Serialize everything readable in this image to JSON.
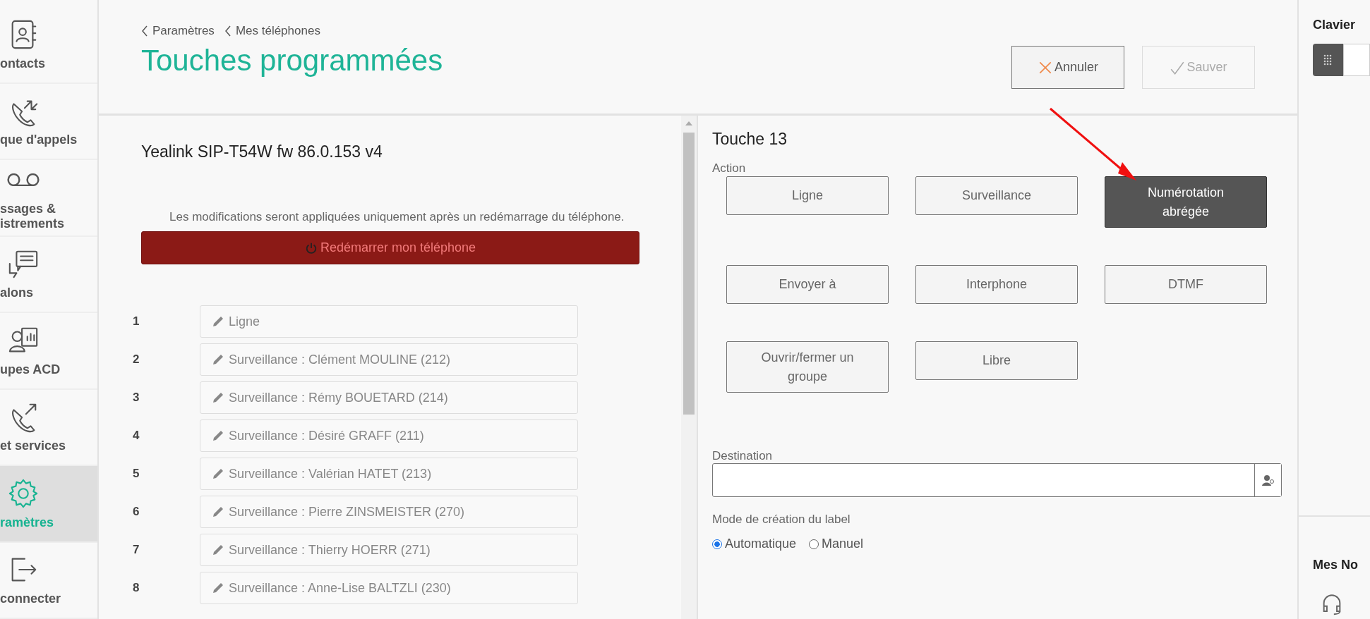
{
  "sidebar": {
    "items": [
      {
        "label": "ontacts",
        "kind": "contacts",
        "selected": false
      },
      {
        "label": "que d'appels",
        "kind": "history",
        "selected": false
      },
      {
        "label": "ssages &\nistrements",
        "kind": "voicemail",
        "selected": false
      },
      {
        "label": "alons",
        "kind": "chat",
        "selected": false
      },
      {
        "label": "upes ACD",
        "kind": "acd",
        "selected": false
      },
      {
        "label": "et services",
        "kind": "services",
        "selected": false
      },
      {
        "label": "ramètres",
        "kind": "settings",
        "selected": true
      },
      {
        "label": "connecter",
        "kind": "logout",
        "selected": false
      }
    ]
  },
  "header": {
    "breadcrumbs": [
      "Paramètres",
      "Mes téléphones"
    ],
    "title": "Touches programmées",
    "buttons": [
      {
        "label": "Annuler",
        "kind": "cancel",
        "disabled": false
      },
      {
        "label": "Sauver",
        "kind": "save",
        "disabled": true
      }
    ]
  },
  "phone_panel": {
    "model": "Yealink SIP-T54W fw 86.0.153 v4",
    "notice": "Les modifications seront appliquées uniquement après un redémarrage du téléphone.",
    "restart_button": "Redémarrer mon téléphone",
    "keys": [
      {
        "number": "1",
        "label": "Ligne"
      },
      {
        "number": "2",
        "label": "Surveillance : Clément MOULINE (212)"
      },
      {
        "number": "3",
        "label": "Surveillance : Rémy BOUETARD (214)"
      },
      {
        "number": "4",
        "label": "Surveillance : Désiré GRAFF (211)"
      },
      {
        "number": "5",
        "label": "Surveillance : Valérian HATET (213)"
      },
      {
        "number": "6",
        "label": "Surveillance : Pierre ZINSMEISTER (270)"
      },
      {
        "number": "7",
        "label": "Surveillance : Thierry HOERR (271)"
      },
      {
        "number": "8",
        "label": "Surveillance : Anne-Lise BALTZLI (230)"
      }
    ]
  },
  "key_editor": {
    "title": "Touche 13",
    "action_label": "Action",
    "actions": [
      {
        "label": "Ligne",
        "selected": false
      },
      {
        "label": "Surveillance",
        "selected": false
      },
      {
        "label": "Numérotation abrégée",
        "selected": true
      },
      {
        "label": "Envoyer à",
        "selected": false
      },
      {
        "label": "Interphone",
        "selected": false
      },
      {
        "label": "DTMF",
        "selected": false
      },
      {
        "label": "Ouvrir/fermer un groupe",
        "selected": false
      },
      {
        "label": "Libre",
        "selected": false
      }
    ],
    "destination_label": "Destination",
    "label_mode_label": "Mode de création du label",
    "label_modes": [
      {
        "label": "Automatique",
        "selected": true
      },
      {
        "label": "Manuel",
        "selected": false
      }
    ]
  },
  "right_column": {
    "keypad_title": "Clavier",
    "notifications_title": "Mes No"
  }
}
